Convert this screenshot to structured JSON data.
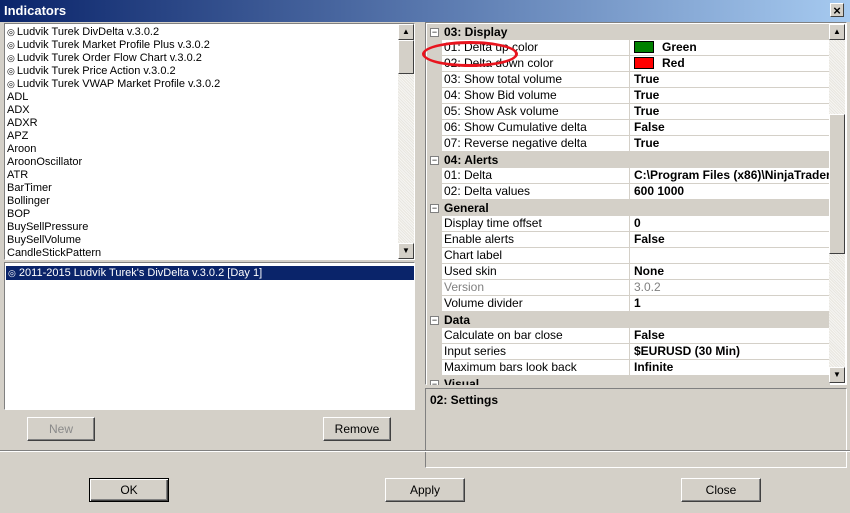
{
  "window": {
    "title": "Indicators",
    "close_glyph": "×"
  },
  "indicator_list": {
    "items": [
      {
        "label": "Ludvik Turek DivDelta v.3.0.2",
        "icon": "indicator-symbol-icon"
      },
      {
        "label": "Ludvik Turek Market Profile Plus v.3.0.2",
        "icon": "indicator-symbol-icon"
      },
      {
        "label": "Ludvik Turek Order Flow Chart v.3.0.2",
        "icon": "indicator-symbol-icon"
      },
      {
        "label": "Ludvik Turek Price Action v.3.0.2",
        "icon": "indicator-symbol-icon"
      },
      {
        "label": "Ludvik Turek VWAP Market Profile v.3.0.2",
        "icon": "indicator-symbol-icon"
      },
      {
        "label": "ADL"
      },
      {
        "label": "ADX"
      },
      {
        "label": "ADXR"
      },
      {
        "label": "APZ"
      },
      {
        "label": "Aroon"
      },
      {
        "label": "AroonOscillator"
      },
      {
        "label": "ATR"
      },
      {
        "label": "BarTimer"
      },
      {
        "label": "Bollinger"
      },
      {
        "label": "BOP"
      },
      {
        "label": "BuySellPressure"
      },
      {
        "label": "BuySellVolume"
      },
      {
        "label": "CandleStickPattern"
      }
    ]
  },
  "instance_list": {
    "selected": "2011-2015 Ludvík Turek's DivDelta v.3.0.2 [Day 1]"
  },
  "buttons": {
    "new": "New",
    "remove": "Remove",
    "ok": "OK",
    "apply": "Apply",
    "close": "Close"
  },
  "property_grid": {
    "categories": [
      {
        "name": "03: Display",
        "toggle": "⊟",
        "rows": [
          {
            "name": "01: Delta up color",
            "value": "Green",
            "swatch": "#008000"
          },
          {
            "name": "02: Delta down color",
            "value": "Red",
            "swatch": "#ff0000"
          },
          {
            "name": "03: Show total volume",
            "value": "True"
          },
          {
            "name": "04: Show Bid volume",
            "value": "True"
          },
          {
            "name": "05: Show Ask volume",
            "value": "True"
          },
          {
            "name": "06: Show Cumulative delta",
            "value": "False"
          },
          {
            "name": "07: Reverse negative delta",
            "value": "True"
          }
        ]
      },
      {
        "name": "04: Alerts",
        "toggle": "⊟",
        "rows": [
          {
            "name": "01: Delta",
            "value": "C:\\Program Files (x86)\\NinjaTrader"
          },
          {
            "name": "02: Delta values",
            "value": "600 1000"
          }
        ]
      },
      {
        "name": "General",
        "toggle": "⊟",
        "rows": [
          {
            "name": "Display time offset",
            "value": "0"
          },
          {
            "name": "Enable alerts",
            "value": "False"
          },
          {
            "name": "Chart label",
            "value": ""
          },
          {
            "name": "Used skin",
            "value": "None"
          },
          {
            "name": "Version",
            "value": "3.0.2",
            "dim": true
          },
          {
            "name": "Volume divider",
            "value": "1"
          }
        ]
      },
      {
        "name": "Data",
        "toggle": "⊟",
        "rows": [
          {
            "name": "Calculate on bar close",
            "value": "False"
          },
          {
            "name": "Input series",
            "value": "$EURUSD (30 Min)"
          },
          {
            "name": "Maximum bars look back",
            "value": "Infinite"
          }
        ]
      },
      {
        "name": "Visual",
        "toggle": "⊟",
        "rows": []
      }
    ]
  },
  "description": {
    "title": "02: Settings"
  },
  "colors": {
    "highlight": "#e8141e",
    "selection": "#0a246a"
  }
}
